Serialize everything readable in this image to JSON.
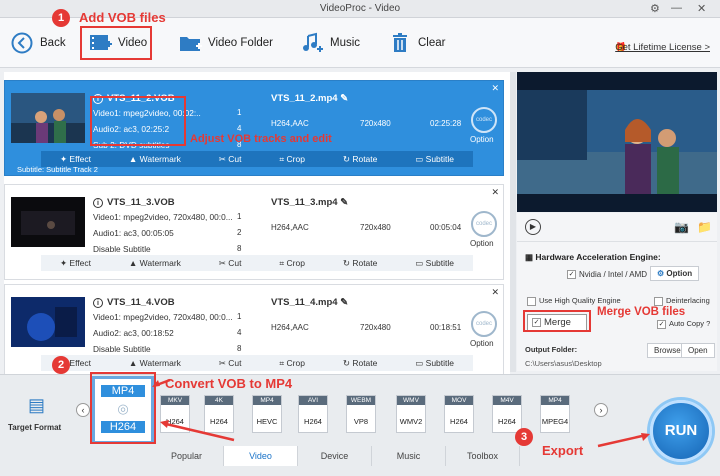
{
  "window": {
    "title": "VideoProc - Video"
  },
  "toolbar": {
    "back": "Back",
    "video": "Video",
    "video_folder": "Video Folder",
    "music": "Music",
    "clear": "Clear",
    "license": "Get Lifetime License >"
  },
  "files": [
    {
      "source": "VTS_11_2.VOB",
      "line1": "Video1: mpeg2video, 00:02:..",
      "line2": "Audio2: ac3, 02:25:2",
      "line3": "Sub 2: DVD subtitles",
      "n1": "1",
      "n2": "4",
      "n3": "8",
      "output": "VTS_11_2.mp4",
      "audio": "H264,AAC",
      "resolution": "720x480",
      "duration": "02:25:28",
      "option": "Option",
      "subtitle_note": "Subtitle: Subtitle Track 2"
    },
    {
      "source": "VTS_11_3.VOB",
      "line1": "Video1: mpeg2video, 720x480, 00:0...",
      "line2": "Audio1: ac3, 00:05:05",
      "line3": "Disable Subtitle",
      "n1": "1",
      "n2": "2",
      "n3": "8",
      "output": "VTS_11_3.mp4",
      "audio": "H264,AAC",
      "resolution": "720x480",
      "duration": "00:05:04",
      "option": "Option",
      "subtitle_note": ""
    },
    {
      "source": "VTS_11_4.VOB",
      "line1": "Video1: mpeg2video, 720x480, 00:0...",
      "line2": "Audio2: ac3, 00:18:52",
      "line3": "Disable Subtitle",
      "n1": "1",
      "n2": "4",
      "n3": "8",
      "output": "VTS_11_4.mp4",
      "audio": "H264,AAC",
      "resolution": "720x480",
      "duration": "00:18:51",
      "option": "Option",
      "subtitle_note": ""
    }
  ],
  "tools": {
    "effect": "Effect",
    "watermark": "Watermark",
    "cut": "Cut",
    "crop": "Crop",
    "rotate": "Rotate",
    "subtitle": "Subtitle"
  },
  "settings": {
    "hw_title": "Hardware Acceleration Engine:",
    "nvidia": "Nvidia / Intel / AMD",
    "option": "Option",
    "hq": "Use High Quality Engine",
    "deinterlacing": "Deinterlacing",
    "merge": "Merge",
    "auto_copy": "Auto Copy",
    "output_folder_label": "Output Folder:",
    "output_folder": "C:\\Users\\asus\\Desktop",
    "browse": "Browse",
    "open": "Open"
  },
  "bottom": {
    "target_format": "Target Format",
    "selected": {
      "top": "MP4",
      "bottom": "H264"
    },
    "formats": [
      {
        "top": "MKV",
        "bottom": "H264"
      },
      {
        "top": "4K",
        "bottom": "H264"
      },
      {
        "top": "MP4",
        "bottom": "HEVC"
      },
      {
        "top": "AVI",
        "bottom": "H264"
      },
      {
        "top": "WEBM",
        "bottom": "VP8"
      },
      {
        "top": "WMV",
        "bottom": "WMV2"
      },
      {
        "top": "MOV",
        "bottom": "H264"
      },
      {
        "top": "M4V",
        "bottom": "H264"
      },
      {
        "top": "MP4",
        "bottom": "MPEG4"
      }
    ],
    "tabs": [
      "Popular",
      "Video",
      "Device",
      "Music",
      "Toolbox"
    ],
    "run": "RUN"
  },
  "annotations": {
    "a1": "Add VOB files",
    "a_tracks": "Adjust VOB tracks and edit",
    "a_merge": "Merge VOB files",
    "a2": "Convert VOB to MP4",
    "a3": "Export",
    "b1": "1",
    "b2": "2",
    "b3": "3"
  },
  "colors": {
    "accent": "#2f8fdd",
    "annotation": "#e53935"
  }
}
